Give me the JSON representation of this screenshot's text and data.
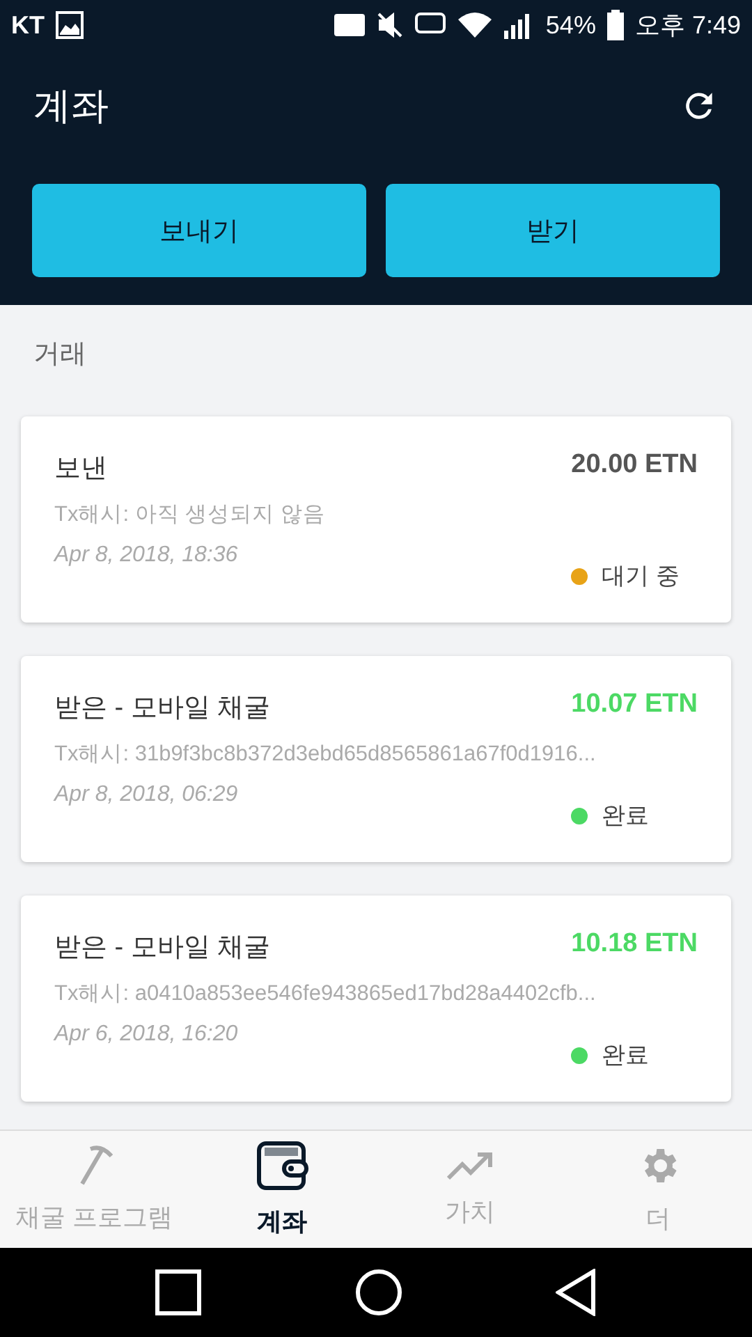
{
  "status_bar": {
    "carrier": "KT",
    "battery": "54%",
    "time": "오후 7:49"
  },
  "header": {
    "title": "계좌"
  },
  "actions": [
    "보내기",
    "받기"
  ],
  "section_title": "거래",
  "transactions": [
    {
      "kind": "sent",
      "title": "보낸",
      "amount": "20.00 ETN",
      "hash": "Tx해시: 아직 생성되지 않음",
      "date": "Apr 8, 2018, 18:36",
      "status": "대기 중",
      "color": "#e8a317"
    },
    {
      "kind": "received",
      "title": "받은 - 모바일 채굴",
      "amount": "10.07 ETN",
      "hash": "Tx해시: 31b9f3bc8b372d3ebd65d8565861a67f0d1916...",
      "date": "Apr 8, 2018, 06:29",
      "status": "완료",
      "color": "#4cd964"
    },
    {
      "kind": "received",
      "title": "받은 - 모바일 채굴",
      "amount": "10.18 ETN",
      "hash": "Tx해시: a0410a853ee546fe943865ed17bd28a4402cfb...",
      "date": "Apr 6, 2018, 16:20",
      "status": "완료",
      "color": "#4cd964"
    }
  ],
  "bottom_nav": [
    {
      "kind": "pickaxe",
      "label": "채굴 프로그램",
      "selected": false
    },
    {
      "kind": "wallet",
      "label": "계좌",
      "selected": true
    },
    {
      "kind": "trend",
      "label": "가치",
      "selected": false
    },
    {
      "kind": "gear",
      "label": "더",
      "selected": false
    }
  ]
}
